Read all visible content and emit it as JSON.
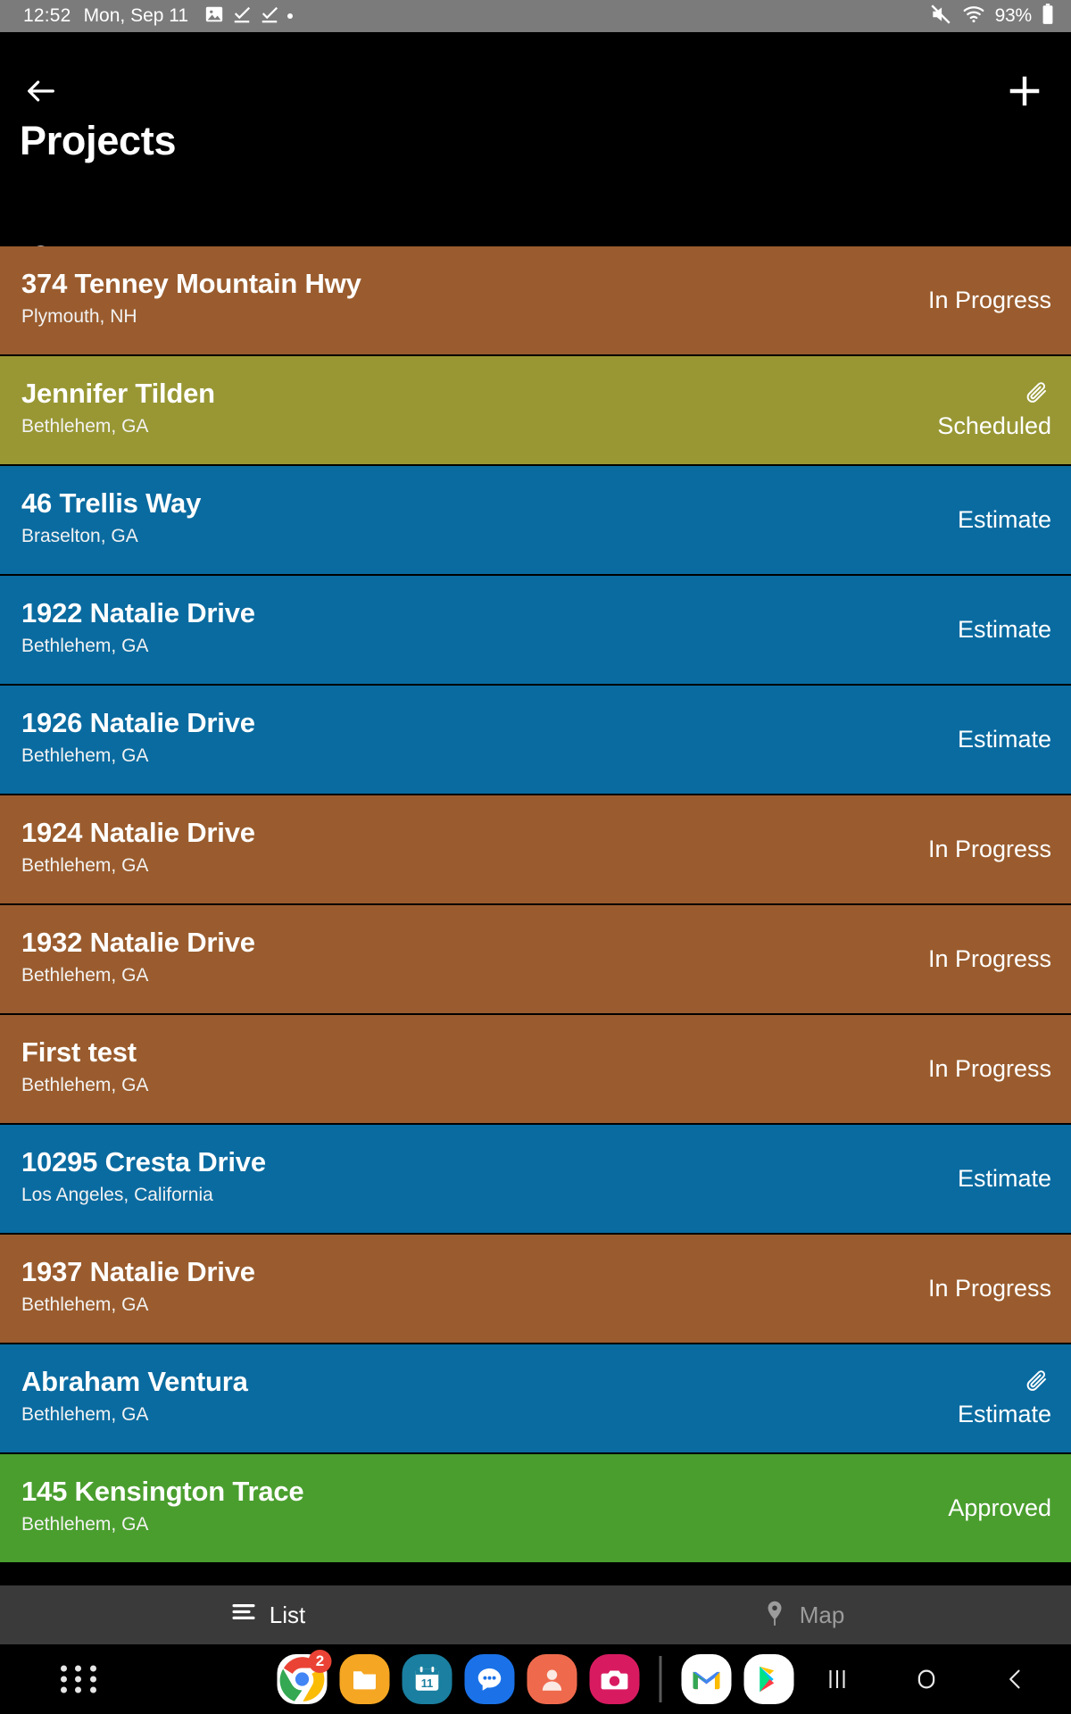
{
  "status_bar": {
    "time": "12:52",
    "date": "Mon, Sep 11",
    "battery_percent": "93%",
    "icons": [
      "image-icon",
      "task-done-icon",
      "task-done-icon",
      "dot-indicator",
      "mute-icon",
      "wifi-icon",
      "battery-icon"
    ]
  },
  "app_bar": {
    "title": "Projects",
    "back_icon": "back-arrow-icon",
    "add_icon": "plus-icon",
    "search_icon": "search-icon",
    "filter_icon": "filter-icon"
  },
  "colors": {
    "status_in_progress": "#9a5c2e",
    "status_scheduled": "#989734",
    "status_estimate": "#0a6ba0",
    "status_approved": "#4a9e2e",
    "app_bar_bg": "#000000",
    "status_bar_bg": "#7b7b7b",
    "tab_bar_bg": "#3a3a3a"
  },
  "projects": [
    {
      "title": "374 Tenney Mountain Hwy",
      "location": "Plymouth, NH",
      "status": "In Progress",
      "color": "#9a5c2e",
      "attachment": false
    },
    {
      "title": "Jennifer Tilden",
      "location": "Bethlehem, GA",
      "status": "Scheduled",
      "color": "#989734",
      "attachment": true
    },
    {
      "title": "46 Trellis Way",
      "location": "Braselton, GA",
      "status": "Estimate",
      "color": "#0a6ba0",
      "attachment": false
    },
    {
      "title": "1922 Natalie Drive",
      "location": "Bethlehem, GA",
      "status": "Estimate",
      "color": "#0a6ba0",
      "attachment": false
    },
    {
      "title": "1926 Natalie Drive",
      "location": "Bethlehem, GA",
      "status": "Estimate",
      "color": "#0a6ba0",
      "attachment": false
    },
    {
      "title": "1924 Natalie Drive",
      "location": "Bethlehem, GA",
      "status": "In Progress",
      "color": "#9a5c2e",
      "attachment": false
    },
    {
      "title": "1932 Natalie Drive",
      "location": "Bethlehem, GA",
      "status": "In Progress",
      "color": "#9a5c2e",
      "attachment": false
    },
    {
      "title": "First test",
      "location": "Bethlehem, GA",
      "status": "In Progress",
      "color": "#9a5c2e",
      "attachment": false
    },
    {
      "title": "10295 Cresta Drive",
      "location": "Los Angeles, California",
      "status": "Estimate",
      "color": "#0a6ba0",
      "attachment": false
    },
    {
      "title": "1937 Natalie Drive",
      "location": "Bethlehem, GA",
      "status": "In Progress",
      "color": "#9a5c2e",
      "attachment": false
    },
    {
      "title": "Abraham Ventura",
      "location": "Bethlehem, GA",
      "status": "Estimate",
      "color": "#0a6ba0",
      "attachment": true
    },
    {
      "title": "145 Kensington Trace",
      "location": "Bethlehem, GA",
      "status": "Approved",
      "color": "#4a9e2e",
      "attachment": false
    }
  ],
  "bottom_tabs": [
    {
      "label": "List",
      "icon": "list-icon",
      "active": true
    },
    {
      "label": "Map",
      "icon": "map-pin-icon",
      "active": false
    }
  ],
  "taskbar": {
    "apps_grid_icon": "apps-grid-icon",
    "apps": [
      {
        "name": "chrome-icon",
        "badge": "2"
      },
      {
        "name": "files-icon",
        "badge": ""
      },
      {
        "name": "calendar-icon",
        "badge": "",
        "day": "11"
      },
      {
        "name": "messages-icon",
        "badge": ""
      },
      {
        "name": "contacts-icon",
        "badge": ""
      },
      {
        "name": "camera-icon",
        "badge": ""
      },
      {
        "name": "gmail-icon",
        "badge": ""
      },
      {
        "name": "play-store-icon",
        "badge": ""
      }
    ],
    "nav_keys": [
      "recents-key",
      "home-key",
      "back-key"
    ]
  }
}
